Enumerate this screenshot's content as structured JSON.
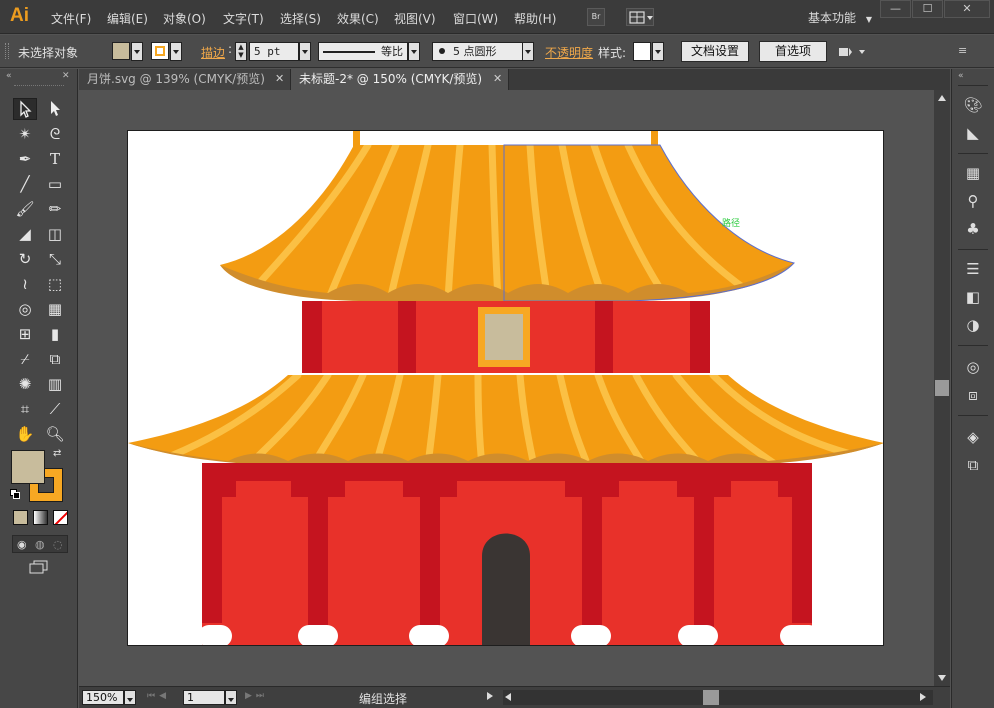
{
  "app": {
    "logo": "Ai",
    "menus": [
      "文件(F)",
      "编辑(E)",
      "对象(O)",
      "文字(T)",
      "选择(S)",
      "效果(C)",
      "视图(V)",
      "窗口(W)",
      "帮助(H)"
    ],
    "bridge_label": "Br",
    "workspace": "基本功能",
    "win_controls": [
      "—",
      "☐",
      "✕"
    ]
  },
  "control": {
    "selection_status": "未选择对象",
    "stroke_label": "描边",
    "stroke_weight": "5 pt",
    "profile_label": "等比",
    "brush_label": "5 点圆形",
    "opacity_label": "不透明度",
    "style_label": "样式:",
    "doc_setup": "文档设置",
    "preferences": "首选项"
  },
  "tabs": [
    {
      "label": "月饼.svg @ 139% (CMYK/预览)",
      "close": "✕",
      "active": false
    },
    {
      "label": "未标题-2* @ 150% (CMYK/预览)",
      "close": "✕",
      "active": true
    }
  ],
  "canvas": {
    "path_hint": "路径"
  },
  "status": {
    "zoom": "150%",
    "artboard_number": "1",
    "tool_status": "编组选择"
  },
  "colors": {
    "fill_swatch": "#c8bc9c",
    "stroke_swatch": "#f7a823",
    "roof_orange": "#f39c12",
    "roof_stripe": "#fbc044",
    "roof_edge": "#d08d2c",
    "wall_red": "#e8312a",
    "pillar_red": "#c5141f",
    "door_dark": "#3a3533"
  }
}
